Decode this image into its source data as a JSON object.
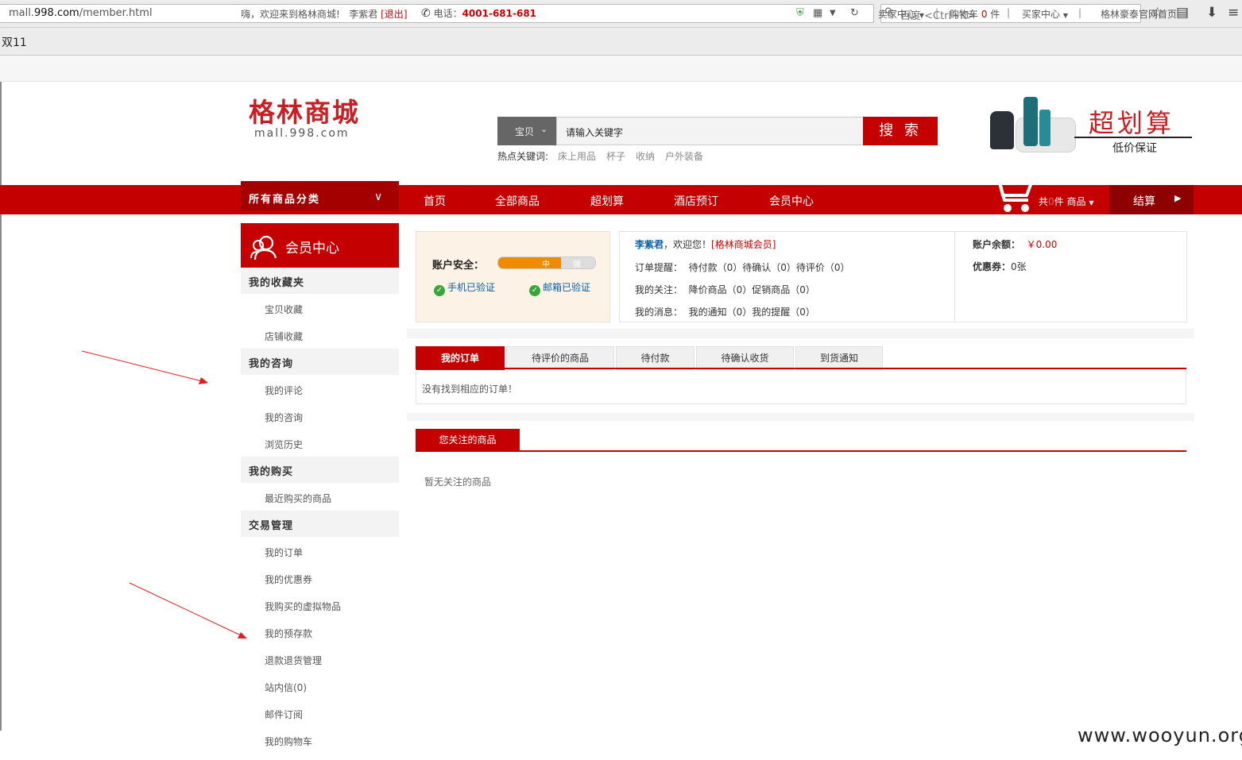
{
  "browser": {
    "url_prefix": "mall.",
    "url_domain": "998.com",
    "url_path": "/member.html",
    "search_placeholder": "百度 <Ctrl+K>",
    "bookmark": "双11"
  },
  "topbar": {
    "welcome": "嗨，欢迎来到格林商城!",
    "username": "李紫君",
    "logout_open": "[",
    "logout": "退出",
    "logout_close": "]",
    "phone_label": "电话：",
    "phone": "4001-681-681",
    "seller_center": "卖家中心",
    "cart_prefix": "购物车",
    "cart_count": "0",
    "cart_suffix": "件",
    "buyer_center": "买家中心",
    "official_home": "格林豪泰官网首页",
    "separator": "|"
  },
  "header": {
    "logo_cn": "格林商城",
    "logo_en": "mall.998.com",
    "search_category": "宝贝",
    "search_input": "请输入关键字",
    "search_button": "搜 索",
    "hot_label": "热点关键词:",
    "hot_keywords": [
      "床上用品",
      "杯子",
      "收纳",
      "户外装备"
    ],
    "promo_title": "超划算",
    "promo_sub": "低价保证"
  },
  "nav": {
    "all_categories": "所有商品分类",
    "links": [
      "首页",
      "全部商品",
      "超划算",
      "酒店预订",
      "会员中心"
    ],
    "cart_prefix": "共",
    "cart_count": "0",
    "cart_suffix": "件 商品",
    "checkout": "结算"
  },
  "sidebar": {
    "title": "会员中心",
    "groups": [
      {
        "title": "我的收藏夹",
        "items": [
          "宝贝收藏",
          "店铺收藏"
        ]
      },
      {
        "title": "我的咨询",
        "items": [
          "我的评论",
          "我的咨询",
          "浏览历史"
        ]
      },
      {
        "title": "我的购买",
        "items": [
          "最近购买的商品"
        ]
      },
      {
        "title": "交易管理",
        "items": [
          "我的订单",
          "我的优惠券",
          "我购买的虚拟物品",
          "我的预存款",
          "退款退货管理",
          "站内信(0)",
          "邮件订阅",
          "我的购物车"
        ]
      }
    ]
  },
  "account": {
    "security_label": "账户安全：",
    "security_level": 0.65,
    "level_mid": "中",
    "level_strong": "强",
    "phone_verified": "手机已验证",
    "email_verified": "邮箱已验证",
    "greeting_name": "李紫君",
    "greeting": "，欢迎您！",
    "member_level": "[格林商城会员]",
    "order_reminder": "订单提醒：  待付款（0）待确认（0）待评价（0）",
    "my_follow": "我的关注：  降价商品（0）促销商品（0）",
    "my_messages": "我的消息：  我的通知（0）我的提醒（0）",
    "balance_label": "账户余额：",
    "balance_value": "￥0.00",
    "coupon_label": "优惠券：",
    "coupon_value": "0张"
  },
  "orders": {
    "tabs": [
      "我的订单",
      "待评价的商品",
      "待付款",
      "待确认收货",
      "到货通知"
    ],
    "empty": "没有找到相应的订单！"
  },
  "followed": {
    "tab": "您关注的商品",
    "empty": "暂无关注的商品"
  },
  "watermark": "www.wooyun.org",
  "colors": {
    "brand_red": "#c40000",
    "link_blue": "#0a5fa8",
    "annotation_arrow": "#e02020"
  }
}
